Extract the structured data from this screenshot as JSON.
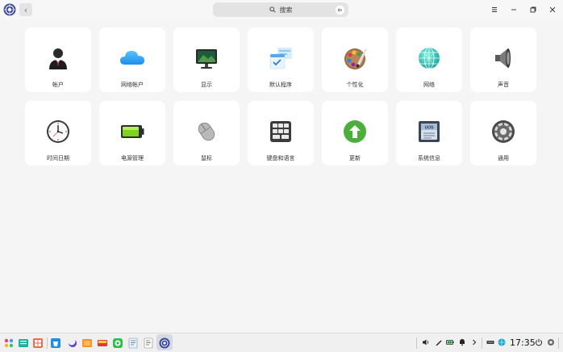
{
  "search": {
    "label": "搜索"
  },
  "tiles": [
    {
      "label": "帐户",
      "icon": "account-icon"
    },
    {
      "label": "网络帐户",
      "icon": "cloud-icon"
    },
    {
      "label": "显示",
      "icon": "monitor-icon"
    },
    {
      "label": "默认程序",
      "icon": "default-apps-icon"
    },
    {
      "label": "个性化",
      "icon": "palette-icon"
    },
    {
      "label": "网络",
      "icon": "network-globe-icon"
    },
    {
      "label": "声音",
      "icon": "speaker-icon"
    },
    {
      "label": "时间日期",
      "icon": "clock-icon"
    },
    {
      "label": "电源管理",
      "icon": "battery-icon"
    },
    {
      "label": "鼠标",
      "icon": "mouse-icon"
    },
    {
      "label": "键盘和语言",
      "icon": "keyboard-icon"
    },
    {
      "label": "更新",
      "icon": "update-arrow-icon"
    },
    {
      "label": "系统信息",
      "icon": "system-info-icon"
    },
    {
      "label": "通用",
      "icon": "gear-icon"
    }
  ],
  "taskbar": {
    "clock": "17:35"
  },
  "colors": {
    "accent": "#2ca7f8",
    "update_green": "#4caf3c"
  }
}
